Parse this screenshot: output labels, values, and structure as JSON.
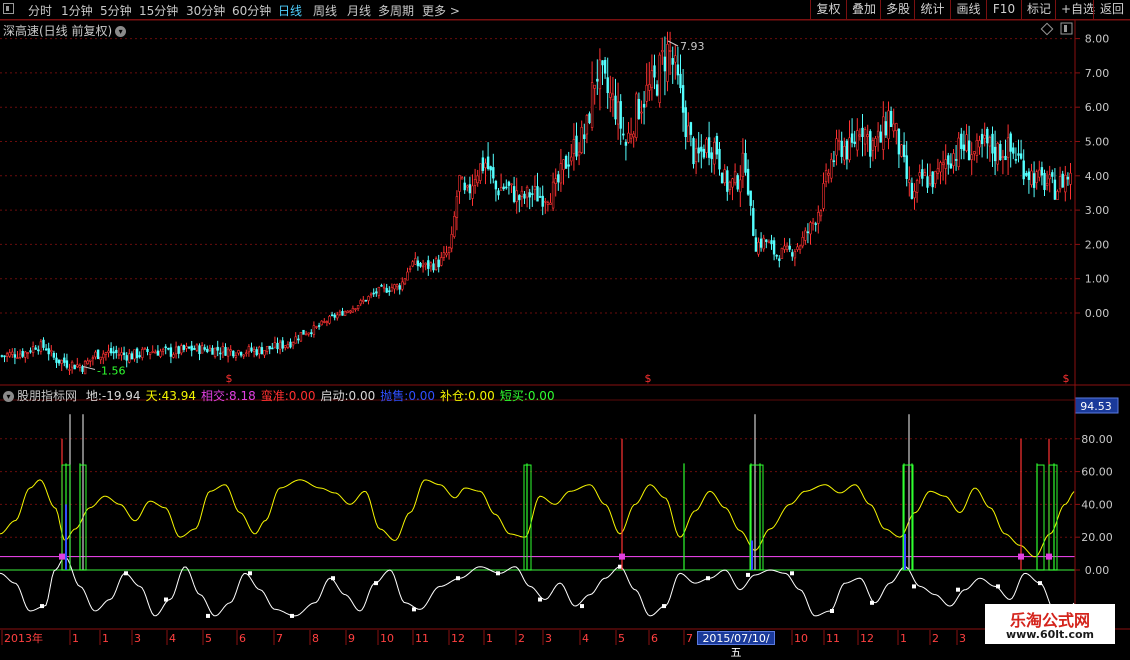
{
  "toolbar": {
    "periods": [
      "分时",
      "1分钟",
      "5分钟",
      "15分钟",
      "30分钟",
      "60分钟",
      "日线",
      "周线",
      "月线",
      "多周期",
      "更多 >"
    ],
    "active_period": "日线",
    "right_buttons": [
      "复权",
      "叠加",
      "多股",
      "统计",
      "画线",
      "F10",
      "标记",
      "+自选",
      "返回"
    ]
  },
  "main_chart": {
    "title": "深高速(日线 前复权)",
    "high_label": "7.93",
    "low_label": "-1.56",
    "signal_mark": "$"
  },
  "indicator": {
    "name": "股朋指标网",
    "fields": [
      {
        "label": "地:",
        "value": "-19.94",
        "color": "#d8d8d8"
      },
      {
        "label": "天:",
        "value": "43.94",
        "color": "#f5f500"
      },
      {
        "label": "相交:",
        "value": "8.18",
        "color": "#e040e0"
      },
      {
        "label": "蛮准:",
        "value": "0.00",
        "color": "#ff3030"
      },
      {
        "label": "启动:",
        "value": "0.00",
        "color": "#d8d8d8"
      },
      {
        "label": "抛售:",
        "value": "0.00",
        "color": "#3050ff"
      },
      {
        "label": "补仓:",
        "value": "0.00",
        "color": "#f5f500"
      },
      {
        "label": "短买:",
        "value": "0.00",
        "color": "#30ff30"
      }
    ],
    "current_value": "94.53"
  },
  "bottom_axis": {
    "labels": [
      "2013年",
      "1",
      "1",
      "3",
      "4",
      "5",
      "6",
      "7",
      "8",
      "9",
      "10",
      "11",
      "12",
      "1",
      "2",
      "3",
      "4",
      "5",
      "6",
      "7",
      "8",
      "9",
      "10",
      "11",
      "12",
      "1",
      "2",
      "3"
    ],
    "selected_date": "2015/07/10/五"
  },
  "watermark": {
    "title": "乐淘公式网",
    "url": "www.60lt.com"
  },
  "chart_data": [
    {
      "type": "candlestick",
      "title": "深高速(日线 前复权)",
      "y_ticks": [
        "8.00",
        "7.00",
        "6.00",
        "5.00",
        "4.00",
        "3.00",
        "2.00",
        "1.00",
        "0.00"
      ],
      "ylim": [
        -0.9,
        8.3
      ],
      "annotations": [
        {
          "label": "7.93",
          "kind": "high"
        },
        {
          "label": "-1.56",
          "kind": "low"
        }
      ],
      "close_series": [
        [
          0,
          -1.25
        ],
        [
          10,
          -1.2
        ],
        [
          25,
          -1.15
        ],
        [
          35,
          -0.95
        ],
        [
          45,
          -1.0
        ],
        [
          52,
          -1.3
        ],
        [
          60,
          -1.4
        ],
        [
          72,
          -1.5
        ],
        [
          83,
          -1.55
        ],
        [
          95,
          -1.2
        ],
        [
          110,
          -1.15
        ],
        [
          130,
          -1.25
        ],
        [
          150,
          -1.1
        ],
        [
          170,
          -1.15
        ],
        [
          190,
          -1.05
        ],
        [
          210,
          -1.05
        ],
        [
          230,
          -1.1
        ],
        [
          255,
          -1.1
        ],
        [
          275,
          -1.0
        ],
        [
          290,
          -0.85
        ],
        [
          300,
          -0.6
        ],
        [
          315,
          -0.45
        ],
        [
          330,
          -0.15
        ],
        [
          345,
          0.05
        ],
        [
          360,
          0.3
        ],
        [
          375,
          0.6
        ],
        [
          390,
          0.75
        ],
        [
          400,
          0.8
        ],
        [
          410,
          1.45
        ],
        [
          425,
          1.35
        ],
        [
          440,
          1.5
        ],
        [
          450,
          1.9
        ],
        [
          458,
          3.9
        ],
        [
          465,
          3.3
        ],
        [
          475,
          4.15
        ],
        [
          485,
          4.4
        ],
        [
          495,
          3.6
        ],
        [
          505,
          3.7
        ],
        [
          520,
          3.3
        ],
        [
          530,
          3.5
        ],
        [
          540,
          3.4
        ],
        [
          555,
          3.6
        ],
        [
          565,
          4.4
        ],
        [
          575,
          4.9
        ],
        [
          585,
          5.2
        ],
        [
          595,
          7.1
        ],
        [
          605,
          6.5
        ],
        [
          615,
          6.0
        ],
        [
          625,
          4.9
        ],
        [
          635,
          5.9
        ],
        [
          645,
          6.4
        ],
        [
          655,
          6.7
        ],
        [
          662,
          7.4
        ],
        [
          668,
          7.7
        ],
        [
          675,
          6.9
        ],
        [
          685,
          5.5
        ],
        [
          695,
          4.4
        ],
        [
          705,
          4.9
        ],
        [
          715,
          4.9
        ],
        [
          725,
          3.7
        ],
        [
          735,
          3.8
        ],
        [
          745,
          4.5
        ],
        [
          750,
          2.8
        ],
        [
          755,
          2.0
        ],
        [
          765,
          2.1
        ],
        [
          775,
          1.7
        ],
        [
          790,
          1.8
        ],
        [
          800,
          2.05
        ],
        [
          810,
          2.5
        ],
        [
          820,
          3.2
        ],
        [
          830,
          4.4
        ],
        [
          840,
          4.9
        ],
        [
          850,
          4.7
        ],
        [
          860,
          5.6
        ],
        [
          870,
          4.9
        ],
        [
          880,
          5.05
        ],
        [
          888,
          5.8
        ],
        [
          895,
          5.2
        ],
        [
          905,
          4.0
        ],
        [
          912,
          3.3
        ],
        [
          920,
          3.9
        ],
        [
          935,
          3.9
        ],
        [
          945,
          4.5
        ],
        [
          955,
          4.7
        ],
        [
          965,
          4.9
        ],
        [
          975,
          4.6
        ],
        [
          985,
          4.9
        ],
        [
          995,
          4.7
        ],
        [
          1005,
          4.8
        ],
        [
          1015,
          4.6
        ],
        [
          1025,
          4.2
        ],
        [
          1035,
          3.9
        ],
        [
          1045,
          3.8
        ],
        [
          1055,
          3.6
        ],
        [
          1065,
          4.0
        ],
        [
          1075,
          3.9
        ]
      ]
    },
    {
      "type": "line",
      "title": "股朋指标网",
      "y_ticks": [
        "80.00",
        "60.00",
        "40.00",
        "20.00",
        "0.00"
      ],
      "ylim": [
        -35,
        100
      ],
      "series": [
        {
          "name": "天",
          "color": "#f5f500",
          "values": [
            [
              0,
              22
            ],
            [
              15,
              30
            ],
            [
              30,
              50
            ],
            [
              40,
              55
            ],
            [
              55,
              38
            ],
            [
              65,
              18
            ],
            [
              75,
              25
            ],
            [
              90,
              38
            ],
            [
              105,
              45
            ],
            [
              120,
              40
            ],
            [
              135,
              30
            ],
            [
              150,
              42
            ],
            [
              165,
              38
            ],
            [
              180,
              20
            ],
            [
              195,
              25
            ],
            [
              210,
              48
            ],
            [
              225,
              52
            ],
            [
              240,
              35
            ],
            [
              255,
              22
            ],
            [
              265,
              30
            ],
            [
              280,
              50
            ],
            [
              300,
              55
            ],
            [
              320,
              50
            ],
            [
              335,
              47
            ],
            [
              350,
              40
            ],
            [
              365,
              48
            ],
            [
              380,
              25
            ],
            [
              395,
              18
            ],
            [
              410,
              35
            ],
            [
              425,
              55
            ],
            [
              440,
              52
            ],
            [
              455,
              44
            ],
            [
              465,
              50
            ],
            [
              480,
              48
            ],
            [
              495,
              34
            ],
            [
              510,
              22
            ],
            [
              525,
              20
            ],
            [
              540,
              45
            ],
            [
              555,
              40
            ],
            [
              570,
              48
            ],
            [
              590,
              52
            ],
            [
              605,
              40
            ],
            [
              620,
              22
            ],
            [
              635,
              40
            ],
            [
              650,
              52
            ],
            [
              665,
              44
            ],
            [
              680,
              20
            ],
            [
              695,
              36
            ],
            [
              710,
              48
            ],
            [
              725,
              38
            ],
            [
              740,
              24
            ],
            [
              755,
              12
            ],
            [
              770,
              25
            ],
            [
              790,
              40
            ],
            [
              805,
              48
            ],
            [
              825,
              52
            ],
            [
              840,
              47
            ],
            [
              855,
              52
            ],
            [
              870,
              40
            ],
            [
              885,
              25
            ],
            [
              900,
              20
            ],
            [
              915,
              35
            ],
            [
              930,
              48
            ],
            [
              945,
              45
            ],
            [
              960,
              35
            ],
            [
              975,
              50
            ],
            [
              990,
              38
            ],
            [
              1005,
              22
            ],
            [
              1020,
              15
            ],
            [
              1035,
              8
            ],
            [
              1050,
              22
            ],
            [
              1065,
              40
            ],
            [
              1075,
              48
            ]
          ]
        },
        {
          "name": "地",
          "color": "#ffffff",
          "values": [
            [
              0,
              -2
            ],
            [
              15,
              -8
            ],
            [
              30,
              -25
            ],
            [
              45,
              -22
            ],
            [
              55,
              0
            ],
            [
              65,
              8
            ],
            [
              80,
              -10
            ],
            [
              95,
              -25
            ],
            [
              110,
              -18
            ],
            [
              125,
              -2
            ],
            [
              140,
              -10
            ],
            [
              155,
              -28
            ],
            [
              170,
              -18
            ],
            [
              185,
              2
            ],
            [
              200,
              -15
            ],
            [
              215,
              -28
            ],
            [
              230,
              -20
            ],
            [
              245,
              -2
            ],
            [
              260,
              -12
            ],
            [
              275,
              -24
            ],
            [
              295,
              -28
            ],
            [
              315,
              -20
            ],
            [
              330,
              -5
            ],
            [
              345,
              -15
            ],
            [
              360,
              -25
            ],
            [
              375,
              -8
            ],
            [
              390,
              0
            ],
            [
              405,
              -20
            ],
            [
              420,
              -24
            ],
            [
              440,
              -10
            ],
            [
              460,
              -5
            ],
            [
              480,
              2
            ],
            [
              500,
              -2
            ],
            [
              515,
              2
            ],
            [
              530,
              -10
            ],
            [
              545,
              -18
            ],
            [
              560,
              -8
            ],
            [
              575,
              -22
            ],
            [
              590,
              -15
            ],
            [
              605,
              -5
            ],
            [
              620,
              2
            ],
            [
              635,
              -12
            ],
            [
              650,
              -28
            ],
            [
              665,
              -22
            ],
            [
              680,
              -2
            ],
            [
              695,
              -8
            ],
            [
              710,
              -5
            ],
            [
              725,
              0
            ],
            [
              740,
              -12
            ],
            [
              755,
              -3
            ],
            [
              770,
              0
            ],
            [
              785,
              -2
            ],
            [
              800,
              -12
            ],
            [
              815,
              -28
            ],
            [
              830,
              -25
            ],
            [
              845,
              -8
            ],
            [
              860,
              -5
            ],
            [
              875,
              -20
            ],
            [
              890,
              -8
            ],
            [
              905,
              2
            ],
            [
              920,
              -10
            ],
            [
              935,
              -15
            ],
            [
              950,
              -22
            ],
            [
              965,
              -12
            ],
            [
              980,
              -5
            ],
            [
              995,
              -10
            ],
            [
              1010,
              -18
            ],
            [
              1025,
              -2
            ],
            [
              1040,
              -8
            ],
            [
              1055,
              -25
            ],
            [
              1065,
              -28
            ],
            [
              1075,
              -20
            ]
          ]
        }
      ],
      "reference_lines": [
        {
          "name": "相交",
          "value": 8.18,
          "color": "#e040e0"
        },
        {
          "name": "zero",
          "value": 0,
          "color": "#30c030"
        }
      ]
    }
  ]
}
